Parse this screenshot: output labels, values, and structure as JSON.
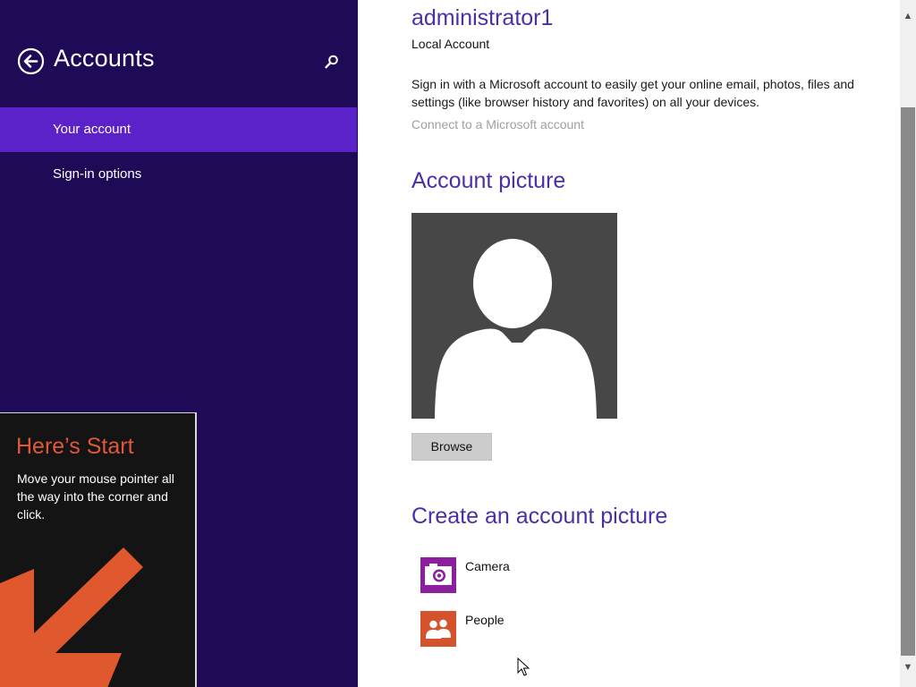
{
  "left_pane": {
    "title": "Accounts",
    "nav_items": [
      {
        "label": "Your account",
        "selected": true
      },
      {
        "label": "Sign-in options",
        "selected": false
      }
    ],
    "accent_color": "#5b22c9",
    "background_color": "#1f0a57"
  },
  "start_tip": {
    "title": "Here’s Start",
    "body": "Move your mouse pointer all the way into the corner and click."
  },
  "account": {
    "username": "administrator1",
    "account_type": "Local Account",
    "signin_info": "Sign in with a Microsoft account to easily get your online email, photos, files and settings (like browser history and favorites) on all your devices.",
    "connect_link": "Connect to a Microsoft account"
  },
  "account_picture": {
    "heading": "Account picture",
    "browse_label": "Browse"
  },
  "create_picture": {
    "heading": "Create an account picture",
    "apps": [
      {
        "label": "Camera",
        "icon": "camera-icon",
        "color": "#8b1f9e"
      },
      {
        "label": "People",
        "icon": "people-icon",
        "color": "#d4532d"
      }
    ]
  },
  "icons": {
    "back": "back-arrow-icon",
    "search": "search-icon",
    "scroll_up": "▲",
    "scroll_down": "▼"
  }
}
